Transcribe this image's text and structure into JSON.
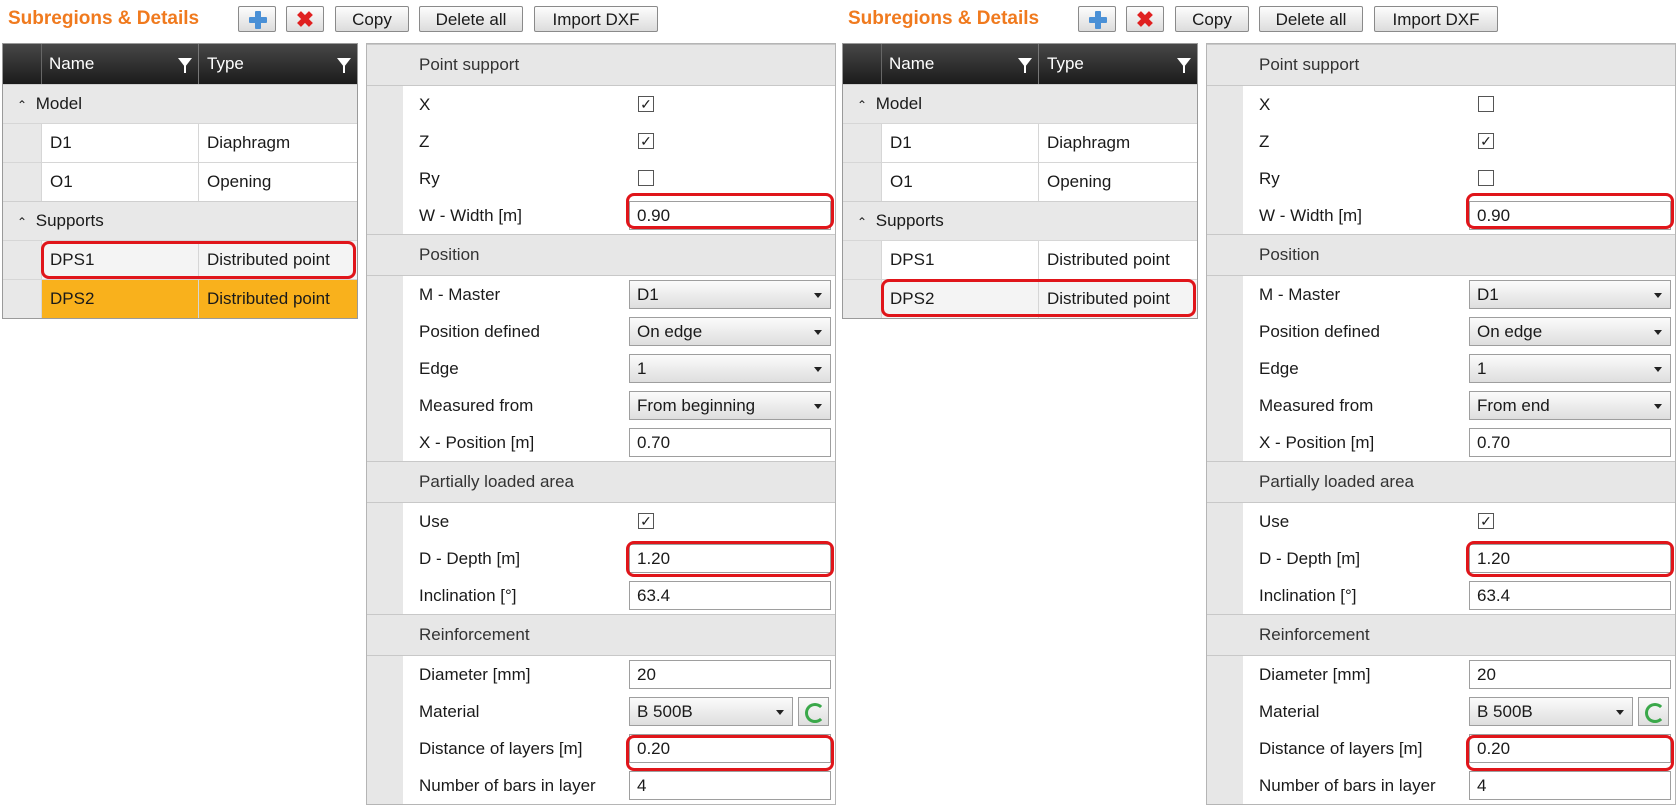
{
  "panels": [
    {
      "toolbar": {
        "title": "Subregions & Details",
        "copy": "Copy",
        "delete_all": "Delete all",
        "import_dxf": "Import DXF"
      },
      "grid": {
        "headers": [
          "Name",
          "Type"
        ],
        "groups": [
          {
            "label": "Model",
            "rows": [
              {
                "name": "D1",
                "type": "Diaphragm"
              },
              {
                "name": "O1",
                "type": "Opening"
              }
            ]
          },
          {
            "label": "Supports",
            "rows": [
              {
                "name": "DPS1",
                "type": "Distributed point"
              },
              {
                "name": "DPS2",
                "type": "Distributed point"
              }
            ]
          }
        ]
      },
      "props": {
        "point_support": {
          "section": "Point support",
          "x_label": "X",
          "x_checked": true,
          "z_label": "Z",
          "z_checked": true,
          "ry_label": "Ry",
          "ry_checked": false,
          "w_label": "W - Width [m]",
          "w_value": "0.90"
        },
        "position": {
          "section": "Position",
          "master_label": "M - Master",
          "master_value": "D1",
          "defined_label": "Position defined",
          "defined_value": "On edge",
          "edge_label": "Edge",
          "edge_value": "1",
          "measured_label": "Measured from",
          "measured_value": "From beginning",
          "x_label": "X - Position [m]",
          "x_value": "0.70"
        },
        "partial": {
          "section": "Partially loaded area",
          "use_label": "Use",
          "use_checked": true,
          "depth_label": "D - Depth [m]",
          "depth_value": "1.20",
          "incl_label": "Inclination [°]",
          "incl_value": "63.4"
        },
        "reinf": {
          "section": "Reinforcement",
          "dia_label": "Diameter [mm]",
          "dia_value": "20",
          "mat_label": "Material",
          "mat_value": "B 500B",
          "dist_label": "Distance of layers [m]",
          "dist_value": "0.20",
          "bars_label": "Number of bars in layer",
          "bars_value": "4"
        }
      }
    },
    {
      "toolbar": {
        "title": "Subregions & Details",
        "copy": "Copy",
        "delete_all": "Delete all",
        "import_dxf": "Import DXF"
      },
      "grid": {
        "headers": [
          "Name",
          "Type"
        ],
        "groups": [
          {
            "label": "Model",
            "rows": [
              {
                "name": "D1",
                "type": "Diaphragm"
              },
              {
                "name": "O1",
                "type": "Opening"
              }
            ]
          },
          {
            "label": "Supports",
            "rows": [
              {
                "name": "DPS1",
                "type": "Distributed point"
              },
              {
                "name": "DPS2",
                "type": "Distributed point"
              }
            ]
          }
        ]
      },
      "props": {
        "point_support": {
          "section": "Point support",
          "x_label": "X",
          "x_checked": false,
          "z_label": "Z",
          "z_checked": true,
          "ry_label": "Ry",
          "ry_checked": false,
          "w_label": "W - Width [m]",
          "w_value": "0.90"
        },
        "position": {
          "section": "Position",
          "master_label": "M - Master",
          "master_value": "D1",
          "defined_label": "Position defined",
          "defined_value": "On edge",
          "edge_label": "Edge",
          "edge_value": "1",
          "measured_label": "Measured from",
          "measured_value": "From end",
          "x_label": "X - Position [m]",
          "x_value": "0.70"
        },
        "partial": {
          "section": "Partially loaded area",
          "use_label": "Use",
          "use_checked": true,
          "depth_label": "D - Depth [m]",
          "depth_value": "1.20",
          "incl_label": "Inclination [°]",
          "incl_value": "63.4"
        },
        "reinf": {
          "section": "Reinforcement",
          "dia_label": "Diameter [mm]",
          "dia_value": "20",
          "mat_label": "Material",
          "mat_value": "B 500B",
          "dist_label": "Distance of layers [m]",
          "dist_value": "0.20",
          "bars_label": "Number of bars in layer",
          "bars_value": "4"
        }
      }
    }
  ],
  "colors": {
    "title": "#f07a1e",
    "selected_row": "#f9b11c",
    "highlight_box": "#e0151a"
  },
  "icons": {
    "add": "plus-icon",
    "delete": "x-icon",
    "filter": "filter-icon",
    "refresh": "refresh-icon"
  }
}
